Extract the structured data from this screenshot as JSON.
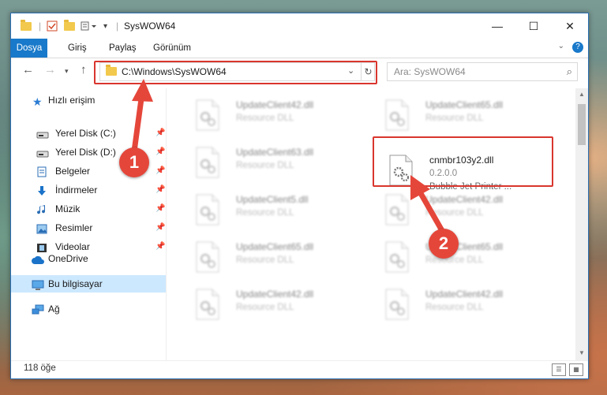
{
  "window": {
    "title": "SysWOW64",
    "controls": {
      "minimize": "—",
      "maximize": "☐",
      "close": "✕"
    }
  },
  "ribbon": {
    "tabs": [
      "Dosya",
      "Giriş",
      "Paylaş",
      "Görünüm"
    ],
    "active_tab": "Dosya"
  },
  "address": {
    "path": "C:\\Windows\\SysWOW64",
    "search_placeholder": "Ara: SysWOW64"
  },
  "sidebar": {
    "quick_access_label": "Hızlı erişim",
    "items": [
      {
        "label": "Yerel Disk (C:)",
        "icon": "drive-icon",
        "pinned": true
      },
      {
        "label": "Yerel Disk (D:)",
        "icon": "drive-icon",
        "pinned": true
      },
      {
        "label": "Belgeler",
        "icon": "documents-icon",
        "pinned": true
      },
      {
        "label": "İndirmeler",
        "icon": "download-icon",
        "pinned": true
      },
      {
        "label": "Müzik",
        "icon": "music-icon",
        "pinned": true
      },
      {
        "label": "Resimler",
        "icon": "pictures-icon",
        "pinned": true
      },
      {
        "label": "Videolar",
        "icon": "videos-icon",
        "pinned": true
      }
    ],
    "onedrive": "OneDrive",
    "this_pc": "Bu bilgisayar",
    "network": "Ağ"
  },
  "files": {
    "left_column": [
      {
        "name": "UpdateClient42.dll",
        "type": "Resource DLL"
      },
      {
        "name": "UpdateClient63.dll",
        "type": "Resource DLL"
      },
      {
        "name": "UpdateClient5.dll",
        "type": "Resource DLL"
      },
      {
        "name": "UpdateClient65.dll",
        "type": "Resource DLL"
      },
      {
        "name": "UpdateClient42.dll",
        "type": "Resource DLL"
      }
    ],
    "right_column": [
      {
        "name": "UpdateClient65.dll",
        "type": "Resource DLL"
      },
      {
        "name": "UpdateClient42.dll",
        "type": "Resource DLL"
      },
      {
        "name": "UpdateClient65.dll",
        "type": "Resource DLL"
      },
      {
        "name": "UpdateClient42.dll",
        "type": "Resource DLL"
      }
    ],
    "highlighted": {
      "name": "cnmbr103y2.dll",
      "version": "0.2.0.0",
      "description": "Bubble Jet Printer ..."
    }
  },
  "status": {
    "count": "118 öğe"
  },
  "callouts": {
    "one": "1",
    "two": "2"
  },
  "colors": {
    "accent": "#1979ca",
    "callout": "#e5463a",
    "highlight_box": "#d9362e",
    "selected": "#cce8ff"
  }
}
